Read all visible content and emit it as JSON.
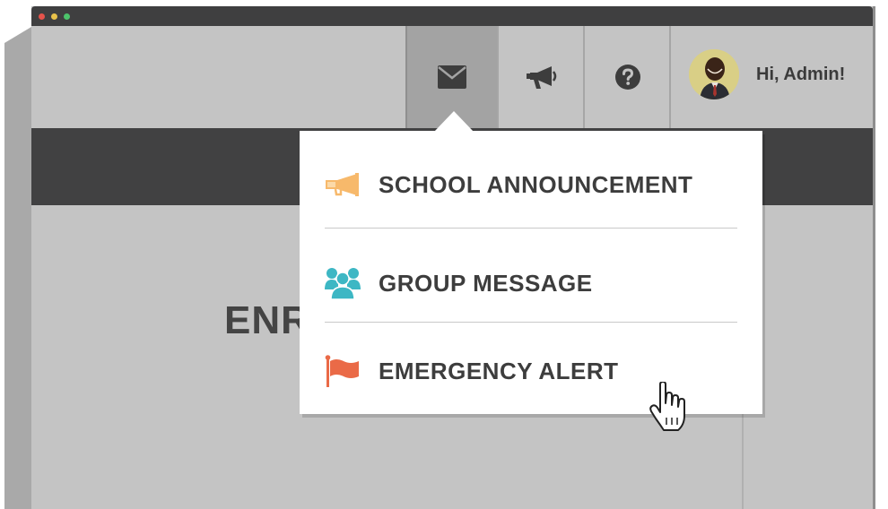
{
  "window": {
    "controls": [
      "close",
      "minimize",
      "maximize"
    ],
    "colors": {
      "close": "#e5534b",
      "minimize": "#e8c14a",
      "maximize": "#4cc36b"
    }
  },
  "topnav": {
    "buttons": [
      {
        "icon": "envelope-icon",
        "active": true
      },
      {
        "icon": "megaphone-icon",
        "active": false
      },
      {
        "icon": "question-circle-icon",
        "active": false
      }
    ],
    "profile": {
      "greeting": "Hi, Admin!",
      "avatar_icon": "user-avatar"
    }
  },
  "main": {
    "heading_partial": "ENR"
  },
  "dropdown": {
    "items": [
      {
        "label": "SCHOOL ANNOUNCEMENT",
        "icon": "megaphone-icon",
        "icon_color": "#f7b96b"
      },
      {
        "label": "GROUP MESSAGE",
        "icon": "group-icon",
        "icon_color": "#3db7c4"
      },
      {
        "label": "EMERGENCY ALERT",
        "icon": "flag-icon",
        "icon_color": "#ea6a47"
      }
    ]
  },
  "cursor": {
    "icon": "hand-pointer-icon"
  },
  "colors": {
    "titlebar": "#3f3f40",
    "darkbar": "#414142",
    "background": "#c4c4c4",
    "active_tab": "#a3a3a3",
    "text": "#3d3d3d"
  }
}
